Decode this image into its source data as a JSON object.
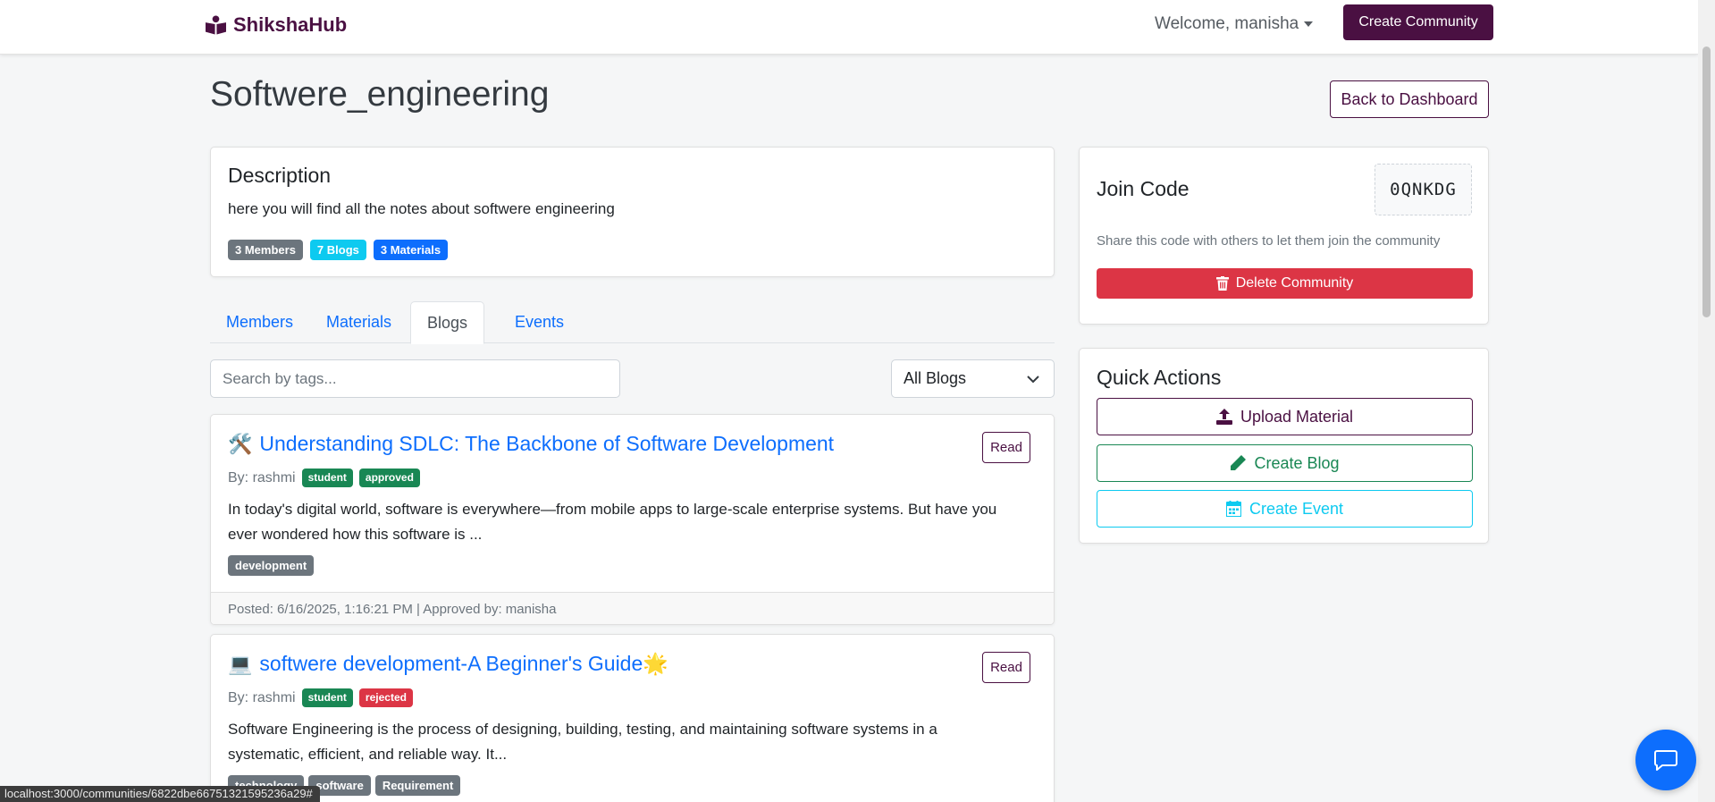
{
  "navbar": {
    "brand": "ShikshaHub",
    "welcome": "Welcome, manisha",
    "create_community": "Create Community"
  },
  "page": {
    "title": "Softwere_engineering",
    "back_label": "Back to Dashboard"
  },
  "description": {
    "heading": "Description",
    "text": "here you will find all the notes about softwere engineering",
    "badges": [
      "3 Members",
      "7 Blogs",
      "3 Materials"
    ]
  },
  "tabs": [
    "Members",
    "Materials",
    "Blogs",
    "Events"
  ],
  "active_tab": "Blogs",
  "filters": {
    "search_placeholder": "Search by tags...",
    "blog_filter": "All Blogs"
  },
  "blogs": [
    {
      "emoji": "🛠️",
      "title": "Understanding SDLC: The Backbone of Software Development",
      "read_label": "Read",
      "by": "By: rashmi",
      "role": "student",
      "status": "approved",
      "excerpt": "In today's digital world, software is everywhere—from mobile apps to large-scale enterprise systems. But have you ever wondered how this software is ...",
      "tags": [
        "development"
      ],
      "footer": "Posted: 6/16/2025, 1:16:21 PM | Approved by: manisha"
    },
    {
      "emoji": "💻",
      "title": "softwere development-A Beginner's Guide🌟",
      "read_label": "Read",
      "by": "By: rashmi",
      "role": "student",
      "status": "rejected",
      "excerpt": "Software Engineering is the process of designing, building, testing, and maintaining software systems in a systematic, efficient, and reliable way. It...",
      "tags": [
        "technology",
        "software",
        "Requirement"
      ]
    }
  ],
  "join": {
    "heading": "Join Code",
    "code": "0QNKDG",
    "hint": "Share this code with others to let them join the community",
    "delete_label": "Delete Community"
  },
  "quick_actions": {
    "heading": "Quick Actions",
    "upload": "Upload Material",
    "blog": "Create Blog",
    "event": "Create Event"
  },
  "status_url": "localhost:3000/communities/6822dbe66751321595236a29#",
  "colors": {
    "brand": "#4a1042",
    "primary": "#0d6efd",
    "danger": "#dc3545",
    "success": "#198754",
    "info": "#0dcaf0",
    "secondary": "#6c757d"
  },
  "icons": {
    "brand": "book-reader-icon",
    "delete": "trash-icon",
    "upload": "upload-icon",
    "blog": "pencil-icon",
    "event": "calendar-icon",
    "chat": "chat-bubble-icon",
    "select": "chevron-down-icon"
  }
}
